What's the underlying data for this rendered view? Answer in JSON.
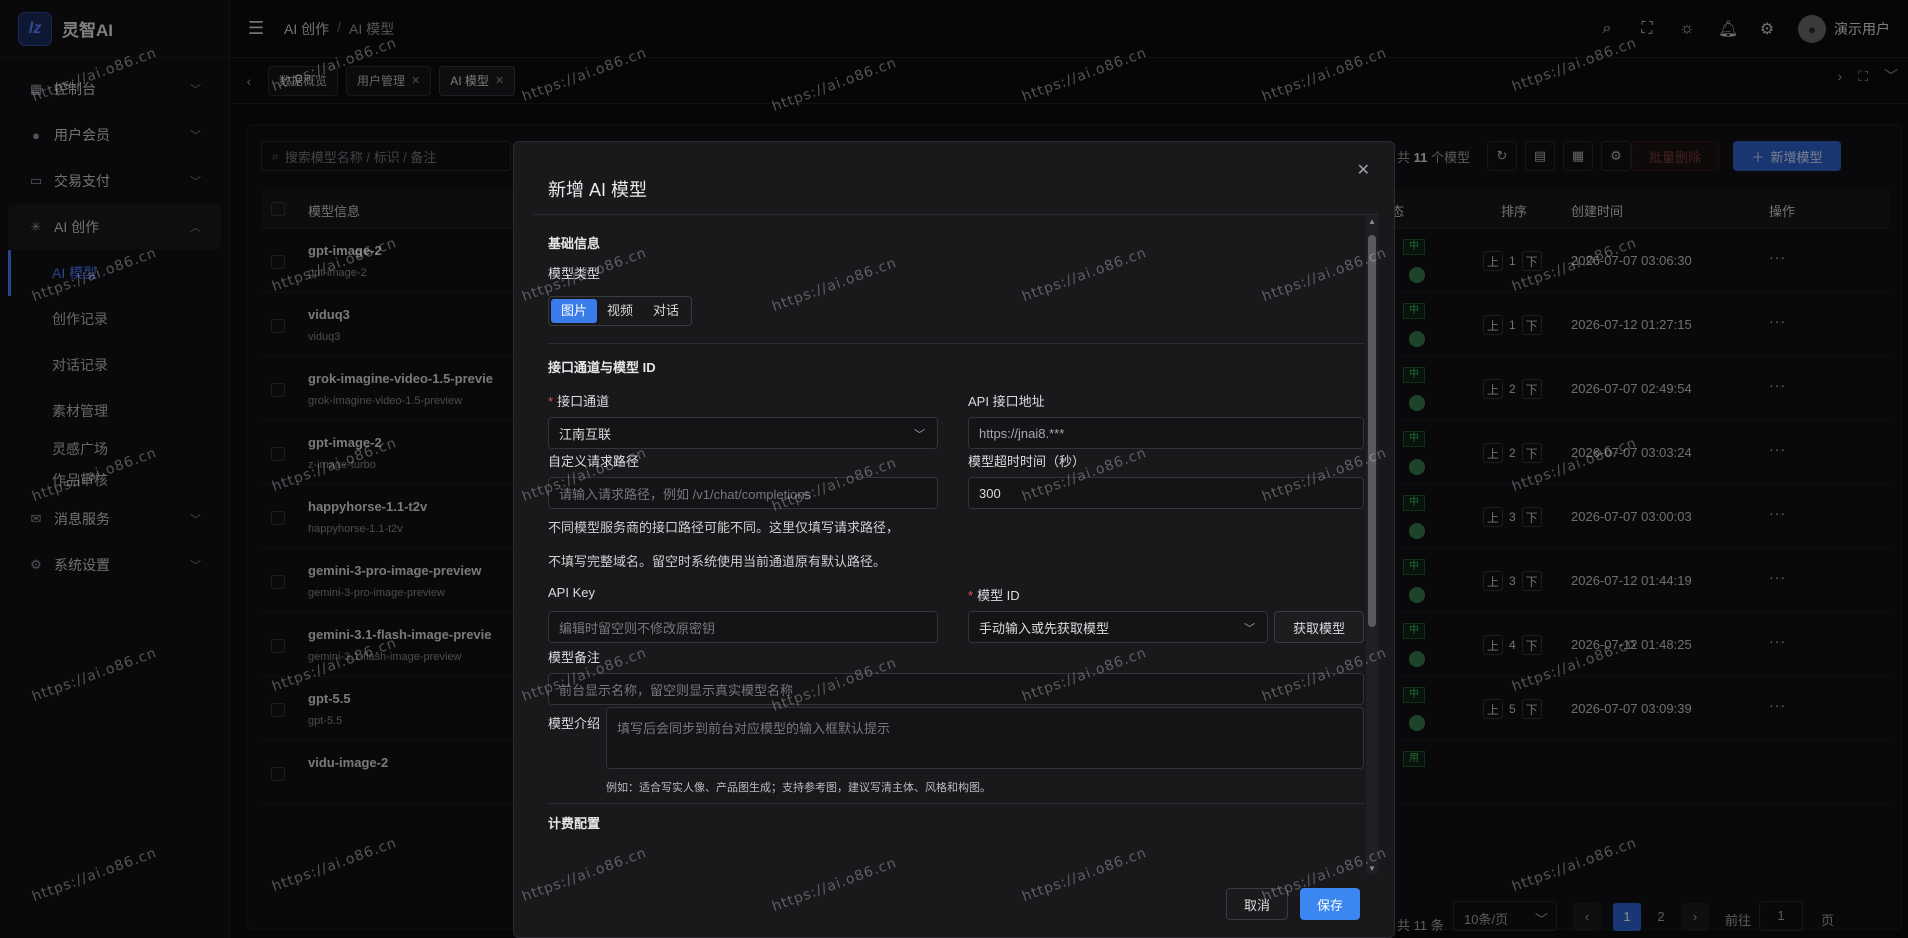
{
  "brand": {
    "logo_mark": "lz",
    "name": "灵智AI"
  },
  "sidebar": {
    "items": [
      {
        "label": "控制台",
        "icon": "dashboard-icon"
      },
      {
        "label": "用户会员",
        "icon": "user-icon"
      },
      {
        "label": "交易支付",
        "icon": "wallet-icon"
      },
      {
        "label": "AI 创作",
        "icon": "sparkle-icon"
      },
      {
        "label": "消息服务",
        "icon": "mail-icon"
      },
      {
        "label": "系统设置",
        "icon": "gear-icon"
      }
    ],
    "subitems": [
      "AI 模型",
      "创作记录",
      "对话记录",
      "素材管理",
      "灵感广场",
      "作品审核"
    ]
  },
  "header": {
    "breadcrumb": [
      "AI 创作",
      "AI 模型"
    ],
    "user_name": "演示用户"
  },
  "tabs": [
    {
      "label": "数据概览"
    },
    {
      "label": "用户管理"
    },
    {
      "label": "AI 模型"
    }
  ],
  "toolbar": {
    "search_placeholder": "搜索模型名称 / 标识 / 备注",
    "count_prefix": "共",
    "count": "11",
    "count_suffix": "个模型",
    "bulk_delete": "批量删除",
    "add_model": "新增模型"
  },
  "table": {
    "headers": {
      "info": "模型信息",
      "status": "态",
      "order": "排序",
      "created": "创建时间",
      "actions": "操作"
    },
    "up_label": "上",
    "down_label": "下",
    "more": "···",
    "rows": [
      {
        "name": "gpt-image-2",
        "id": "gpt-image-2",
        "status": "中",
        "order": "1",
        "created": "2026-07-07 03:06:30"
      },
      {
        "name": "viduq3",
        "id": "viduq3",
        "status": "中",
        "order": "1",
        "created": "2026-07-12 01:27:15"
      },
      {
        "name": "grok-imagine-video-1.5-previe",
        "id": "grok-imagine-video-1.5-preview",
        "status": "中",
        "order": "2",
        "created": "2026-07-07 02:49:54"
      },
      {
        "name": "gpt-image-2",
        "id": "z-image-turbo",
        "status": "中",
        "order": "2",
        "created": "2026-07-07 03:03:24"
      },
      {
        "name": "happyhorse-1.1-t2v",
        "id": "happyhorse-1.1-t2v",
        "status": "中",
        "order": "3",
        "created": "2026-07-07 03:00:03"
      },
      {
        "name": "gemini-3-pro-image-preview",
        "id": "gemini-3-pro-image-preview",
        "status": "中",
        "order": "3",
        "created": "2026-07-12 01:44:19"
      },
      {
        "name": "gemini-3.1-flash-image-previe",
        "id": "gemini-3.1-flash-image-preview",
        "status": "中",
        "order": "4",
        "created": "2026-07-12 01:48:25"
      },
      {
        "name": "gpt-5.5",
        "id": "gpt-5.5",
        "status": "中",
        "order": "5",
        "created": "2026-07-07 03:09:39"
      },
      {
        "name": "vidu-image-2",
        "id": "",
        "status": "用",
        "order": "",
        "created": ""
      }
    ]
  },
  "pagination": {
    "total": "共 11 条",
    "page_size": "10条/页",
    "pages": [
      "1",
      "2"
    ],
    "goto_label": "前往",
    "goto_value": "1",
    "page_suffix": "页"
  },
  "modal": {
    "title": "新增 AI 模型",
    "section_basic": "基础信息",
    "type_label": "模型类型",
    "type_options": [
      "图片",
      "视频",
      "对话"
    ],
    "section_channel": "接口通道与模型 ID",
    "channel_label": "接口通道",
    "channel_value": "江南互联",
    "api_url_label": "API 接口地址",
    "api_url_value": "https://jnai8.***",
    "path_label": "自定义请求路径",
    "path_placeholder": "请输入请求路径，例如 /v1/chat/completions",
    "timeout_label": "模型超时时间（秒）",
    "timeout_value": "300",
    "hint1": "不同模型服务商的接口路径可能不同。这里仅填写请求路径，",
    "hint2": "不填写完整域名。留空时系统使用当前通道原有默认路径。",
    "apikey_label": "API Key",
    "apikey_placeholder": "编辑时留空则不修改原密钥",
    "model_id_label": "模型 ID",
    "model_id_placeholder": "手动输入或先获取模型",
    "fetch_button": "获取模型",
    "note_label": "模型备注",
    "note_placeholder": "前台显示名称，留空则显示真实模型名称",
    "intro_label": "模型介绍",
    "intro_placeholder": "填写后会同步到前台对应模型的输入框默认提示",
    "intro_example": "例如：适合写实人像、产品图生成；支持参考图，建议写清主体、风格和构图。",
    "section_billing": "计费配置",
    "cancel": "取消",
    "save": "保存"
  },
  "watermark": "https://ai.o86.cn"
}
